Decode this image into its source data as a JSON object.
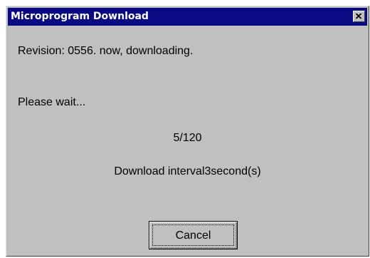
{
  "window": {
    "title": "Microprogram Download",
    "close_icon": "close-icon"
  },
  "body": {
    "revision_message": "Revision: 0556. now, downloading.",
    "wait_message": "Please wait...",
    "progress_counter": "5/120",
    "interval_message": "Download interval3second(s)"
  },
  "buttons": {
    "cancel_label": "Cancel"
  },
  "colors": {
    "title_bar": "#0a0a84",
    "dialog_face": "#c0c0c0",
    "title_text": "#ffffff"
  }
}
